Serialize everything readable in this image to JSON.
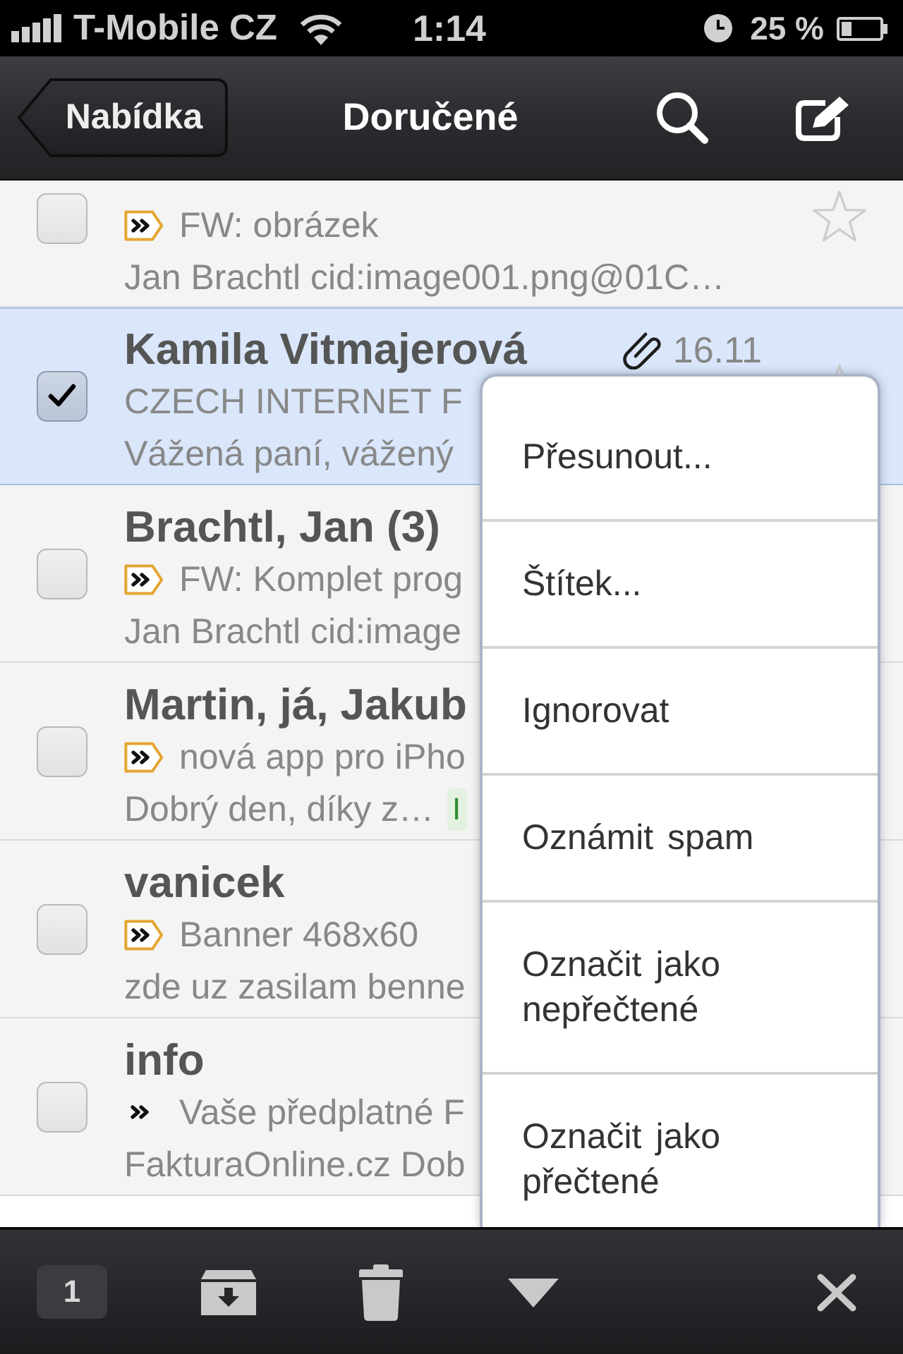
{
  "status_bar": {
    "carrier": "T-Mobile CZ",
    "time": "1:14",
    "battery": "25 %"
  },
  "nav_bar": {
    "back": "Nabídka",
    "title": "Doručené"
  },
  "messages": [
    {
      "checked": false,
      "starred": false,
      "important": true,
      "direct": true,
      "subject": "FW: obrázek",
      "snippet": "Jan Brachtl cid:image001.png@01C…"
    },
    {
      "checked": true,
      "starred": false,
      "sender": "Kamila Vitmajerová",
      "attachment": true,
      "date": "16.11",
      "important": false,
      "direct": false,
      "subject": "CZECH INTERNET F",
      "snippet": "Vážená paní, vážený"
    },
    {
      "checked": false,
      "sender": "Brachtl, Jan (3)",
      "important": true,
      "direct": true,
      "subject": "FW: Komplet prog",
      "snippet": "Jan Brachtl cid:image"
    },
    {
      "checked": false,
      "sender": "Martin, já, Jakub",
      "important": true,
      "direct": true,
      "subject": "nová app pro iPho",
      "snippet": "Dobrý den, díky z…",
      "label": "I"
    },
    {
      "checked": false,
      "sender": "vanicek",
      "important": true,
      "direct": true,
      "subject": "Banner 468x60",
      "snippet": "zde uz zasilam benne"
    },
    {
      "checked": false,
      "sender": "info",
      "important": false,
      "direct": true,
      "subject": "Vaše předplatné F",
      "snippet": "FakturaOnline.cz Dob"
    }
  ],
  "menu": {
    "items": [
      "Přesunout...",
      "Štítek...",
      "Ignorovat",
      "Oznámit spam",
      "Označit jako nepřečtené",
      "Označit jako přečtené"
    ]
  },
  "toolbar": {
    "selected_count": "1"
  }
}
